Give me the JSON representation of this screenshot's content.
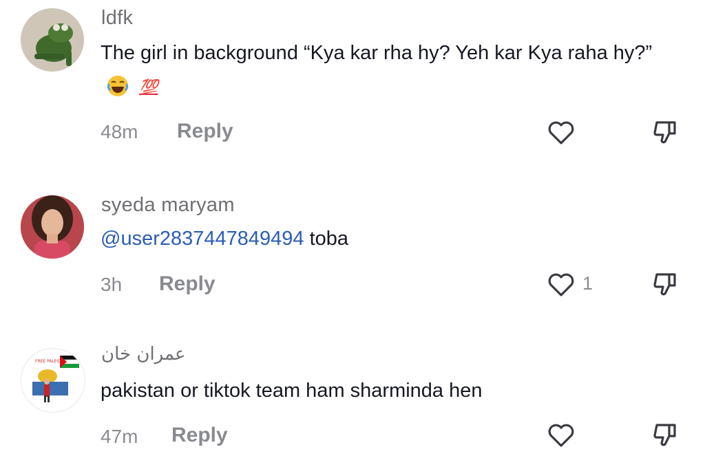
{
  "comments": [
    {
      "username": "ldfk",
      "text": "The girl in background “Kya kar rha hy? Yeh kar Kya raha hy?”",
      "emoji_label": "💯",
      "time": "48m",
      "reply_label": "Reply",
      "likes": ""
    },
    {
      "username": "syeda maryam",
      "mention": "@user2837447849494",
      "text": " toba",
      "time": "3h",
      "reply_label": "Reply",
      "likes": "1"
    },
    {
      "username": "عمران خان",
      "avatar_text": "FREE PALESTINE",
      "text": "pakistan or tiktok team ham sharminda hen",
      "time": "47m",
      "reply_label": "Reply",
      "likes": ""
    }
  ],
  "icons": {
    "like": "heart-outline-icon",
    "dislike": "thumbs-down-outline-icon"
  },
  "colors": {
    "mention": "#2b5db3",
    "meta": "#8a8b91",
    "username": "#6f6f73"
  }
}
